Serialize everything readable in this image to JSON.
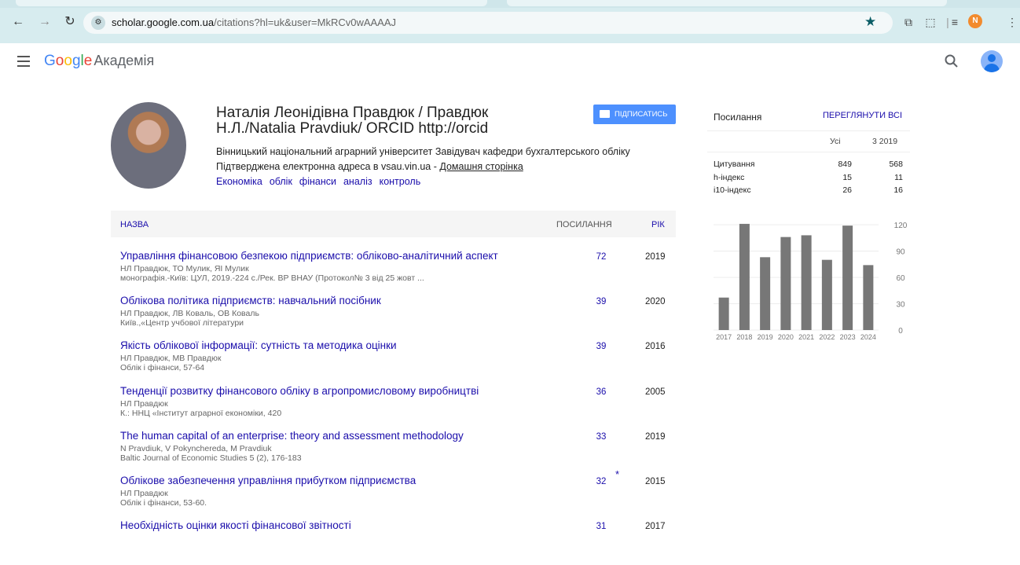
{
  "browser": {
    "url_host": "scholar.google.com.ua",
    "url_path": "/citations?hl=uk&user=MkRCv0wAAAAJ",
    "profile_initial": "N"
  },
  "header": {
    "logo": [
      "G",
      "o",
      "o",
      "g",
      "l",
      "e"
    ],
    "product": "Академія"
  },
  "profile": {
    "name": "Наталія Леонідівна Правдюк / Правдюк Н.Л./Natalia Pravdiuk/ ORCID http://orcid",
    "affiliation": "Вінницький національний аграрний університет Завідувач кафедри бухгалтерського обліку",
    "verified": "Підтверджена електронна адреса в vsau.vin.ua - ",
    "homepage": "Домашня сторінка",
    "interests": [
      "Економіка",
      "облік",
      "фінанси",
      "аналіз",
      "контроль"
    ],
    "follow_label": "ПІДПИСАТИСЬ"
  },
  "table": {
    "col_title": "НАЗВА",
    "col_cited": "ПОСИЛАННЯ",
    "col_year": "РІК",
    "rows": [
      {
        "title": "Управління фінансовою безпекою підприємств: обліково-аналітичний аспект",
        "authors": "НЛ Правдюк, ТО Мулик, ЯІ Мулик",
        "source": "монографія.-Київ: ЦУЛ, 2019.-224 с./Рек. ВР ВНАУ (Протокол№ 3 від 25 жовт ...",
        "cited": "72",
        "star": "",
        "year": "2019"
      },
      {
        "title": "Облікова політика підприємств: навчальний посібник",
        "authors": "НЛ Правдюк, ЛВ Коваль, ОВ Коваль",
        "source": "Київ.,«Центр учбової літератури",
        "cited": "39",
        "star": "",
        "year": "2020"
      },
      {
        "title": "Якість облікової інформації: сутність та методика оцінки",
        "authors": "НЛ Правдюк, МВ Правдюк",
        "source": "Облік і фінанси, 57-64",
        "cited": "39",
        "star": "",
        "year": "2016"
      },
      {
        "title": "Тенденції розвитку фінансового обліку в агропромисловому виробництві",
        "authors": "НЛ Правдюк",
        "source": "К.: ННЦ «Інститут аграрної економіки, 420",
        "cited": "36",
        "star": "",
        "year": "2005"
      },
      {
        "title": "The human capital of an enterprise: theory and assessment methodology",
        "authors": "N Pravdiuk, V Pokynchereda, M Pravdiuk",
        "source": "Baltic Journal of Economic Studies 5 (2), 176-183",
        "cited": "33",
        "star": "",
        "year": "2019"
      },
      {
        "title": "Облікове забезпечення управління прибутком підприємства",
        "authors": "НЛ Правдюк",
        "source": "Облік і фінанси, 53-60.",
        "cited": "32",
        "star": "*",
        "year": "2015"
      },
      {
        "title": "Необхідність оцінки якості фінансової звітності",
        "authors": "",
        "source": "",
        "cited": "31",
        "star": "",
        "year": "2017"
      }
    ]
  },
  "cited_by": {
    "title": "Посилання",
    "view_all": "ПЕРЕГЛЯНУТИ ВСІ",
    "col_all": "Усі",
    "col_since": "3 2019",
    "stats": [
      {
        "label": "Цитування",
        "all": "849",
        "since": "568"
      },
      {
        "label": "h-індекс",
        "all": "15",
        "since": "11"
      },
      {
        "label": "i10-індекс",
        "all": "26",
        "since": "16"
      }
    ]
  },
  "chart_data": {
    "type": "bar",
    "categories": [
      "2017",
      "2018",
      "2019",
      "2020",
      "2021",
      "2022",
      "2023",
      "2024"
    ],
    "values": [
      37,
      121,
      83,
      106,
      108,
      80,
      119,
      74
    ],
    "ylim": [
      0,
      120
    ],
    "yticks": [
      "0",
      "30",
      "60",
      "90",
      "120"
    ],
    "grid": true,
    "bar_color": "#777777"
  }
}
